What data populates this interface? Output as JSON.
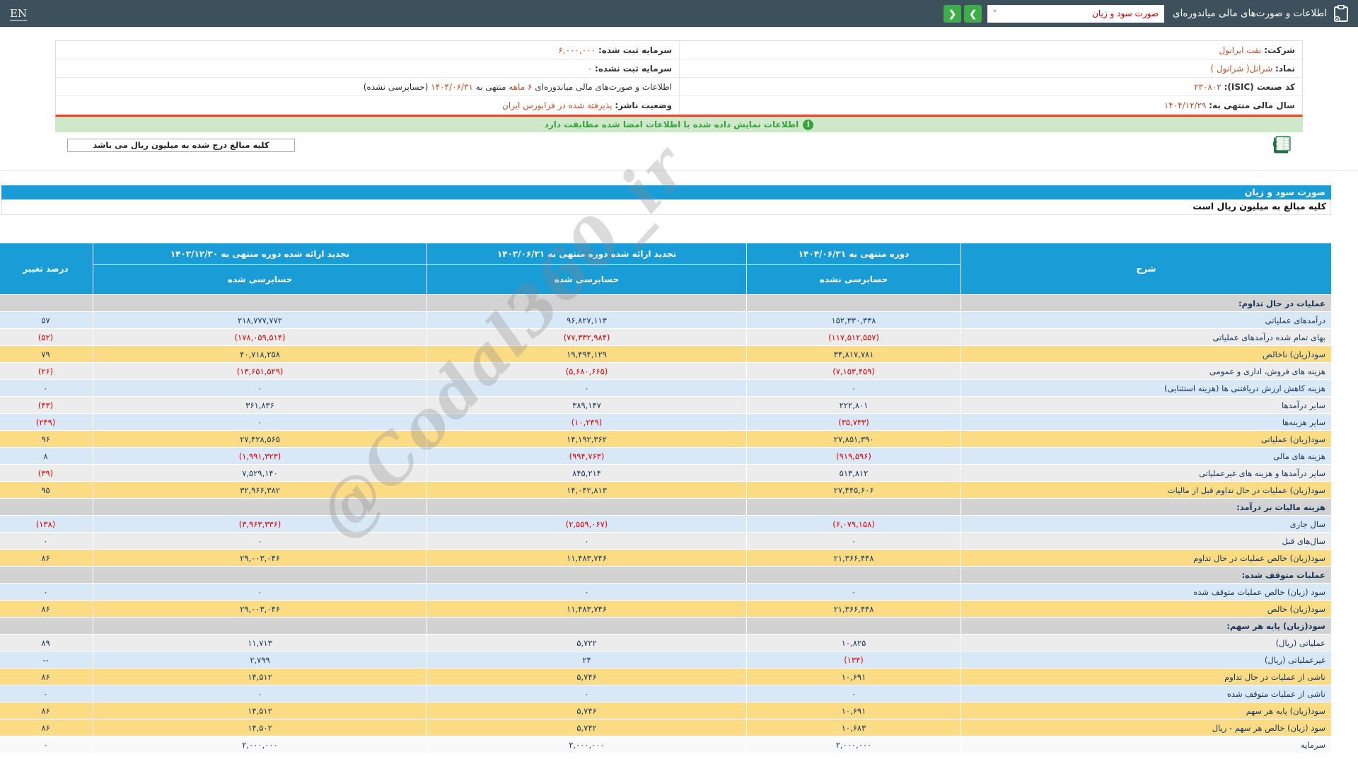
{
  "topbar": {
    "en_label": "EN",
    "title": "اطلاعات و صورت‌های مالی میاندوره‌ای",
    "select_value": "صورت سود و زیان",
    "prev_label": "❮",
    "next_label": "❯"
  },
  "company_info": {
    "right": [
      {
        "label": "شرکت:",
        "value": "نفت ایرانول"
      },
      {
        "label": "نماد:",
        "value": "شرانل( شرانول )"
      },
      {
        "label": "کد صنعت (ISIC):",
        "value": "۲۳۰۸۰۲"
      },
      {
        "label": "سال مالی منتهی به:",
        "value": "۱۴۰۴/۱۲/۲۹"
      }
    ],
    "left1": {
      "label": "سرمایه ثبت شده:",
      "value": "۶,۰۰۰,۰۰۰"
    },
    "left2": {
      "label": "سرمایه ثبت نشده:",
      "value": "۰"
    },
    "period_row": {
      "p1": "اطلاعات و صورت‌های مالی میاندوره‌ای",
      "p2": "۶ ماهه",
      "p3": "منتهی به",
      "p4": "۱۴۰۴/۰۶/۳۱",
      "p5": "(حسابرسی نشده)"
    },
    "left4": {
      "label": "وضعیت ناشر:",
      "value": "پذیرفته شده در فرابورس ایران"
    }
  },
  "notice": "اطلاعات نمایش داده شده با اطلاعات امضا شده مطابقت دارد",
  "info_icon_glyph": "i",
  "unit_box": "کلیه مبالغ درج شده به میلیون ریال می باشد",
  "statement": {
    "title": "صورت سود و زیان",
    "unit_note": "کلیه مبالغ به میلیون ریال است"
  },
  "watermark": "@Codal360_ir",
  "table": {
    "headers": {
      "sharh": "شرح",
      "col1_title": "دوره منتهی به ۱۴۰۴/۰۶/۳۱",
      "col1_sub": "حسابرسی نشده",
      "col2_title": "تجدید ارائه شده دوره منتهی به ۱۴۰۳/۰۶/۳۱",
      "col2_sub": "حسابرسی شده",
      "col3_title": "تجدید ارائه شده دوره منتهی به ۱۴۰۳/۱۲/۳۰",
      "col3_sub": "حسابرسی شده",
      "change": "درصد تغییر"
    },
    "rows": [
      {
        "style": "section",
        "label": "عملیات در حال تداوم:",
        "v": [
          "",
          "",
          ""
        ],
        "change": ""
      },
      {
        "style": "blue",
        "label": "درآمدهای عملیاتی",
        "v": [
          "۱۵۲,۳۳۰,۳۳۸",
          "۹۶,۸۲۷,۱۱۳",
          "۲۱۸,۷۷۷,۷۷۲"
        ],
        "change": "۵۷"
      },
      {
        "style": "gray",
        "label": "بهای تمام شده درآمدهای عملیاتی",
        "v": [
          "(۱۱۷,۵۱۲,۵۵۷)",
          "(۷۷,۳۳۲,۹۸۴)",
          "(۱۷۸,۰۵۹,۵۱۴)"
        ],
        "change": "(۵۲)"
      },
      {
        "style": "yellow",
        "label": "سود(زیان) ناخالص",
        "v": [
          "۳۴,۸۱۷,۷۸۱",
          "۱۹,۴۹۴,۱۲۹",
          "۴۰,۷۱۸,۲۵۸"
        ],
        "change": "۷۹"
      },
      {
        "style": "gray",
        "label": "هزینه های فروش، اداری و عمومی",
        "v": [
          "(۷,۱۵۳,۴۵۹)",
          "(۵,۶۸۰,۶۶۵)",
          "(۱۳,۶۵۱,۵۲۹)"
        ],
        "change": "(۲۶)"
      },
      {
        "style": "blue",
        "label": "هزینه کاهش ارزش دریافتنی ها (هزینه استثنایی)",
        "v": [
          "۰",
          "۰",
          "۰"
        ],
        "change": "۰"
      },
      {
        "style": "gray",
        "label": "سایر درآمدها",
        "v": [
          "۲۲۲,۸۰۱",
          "۳۸۹,۱۴۷",
          "۳۶۱,۸۳۶"
        ],
        "change": "(۴۳)"
      },
      {
        "style": "blue",
        "label": "سایر هزینه‌ها",
        "v": [
          "(۳۵,۷۳۳)",
          "(۱۰,۲۴۹)",
          "۰"
        ],
        "change": "(۲۴۹)"
      },
      {
        "style": "yellow",
        "label": "سود(زیان) عملیاتی",
        "v": [
          "۲۷,۸۵۱,۳۹۰",
          "۱۴,۱۹۲,۳۶۲",
          "۲۷,۴۲۸,۵۶۵"
        ],
        "change": "۹۶"
      },
      {
        "style": "blue",
        "label": "هزینه های مالی",
        "v": [
          "(۹۱۹,۵۹۶)",
          "(۹۹۴,۷۶۳)",
          "(۱,۹۹۱,۳۲۳)"
        ],
        "change": "۸"
      },
      {
        "style": "gray",
        "label": "سایر درآمدها و هزینه های غیرعملیاتی",
        "v": [
          "۵۱۳,۸۱۲",
          "۸۴۵,۲۱۴",
          "۷,۵۲۹,۱۴۰"
        ],
        "change": "(۳۹)"
      },
      {
        "style": "yellow",
        "label": "سود(زیان) عملیات در حال تداوم قبل از مالیات",
        "v": [
          "۲۷,۴۴۵,۶۰۶",
          "۱۴,۰۴۲,۸۱۳",
          "۳۲,۹۶۶,۳۸۲"
        ],
        "change": "۹۵"
      },
      {
        "style": "section",
        "label": "هزینه مالیات بر درآمد:",
        "v": [
          "",
          "",
          ""
        ],
        "change": ""
      },
      {
        "style": "blue",
        "label": "سال جاری",
        "v": [
          "(۶,۰۷۹,۱۵۸)",
          "(۲,۵۵۹,۰۶۷)",
          "(۳,۹۶۳,۳۳۶)"
        ],
        "change": "(۱۳۸)"
      },
      {
        "style": "gray",
        "label": "سال‌های قبل",
        "v": [
          "۰",
          "۰",
          "۰"
        ],
        "change": "۰"
      },
      {
        "style": "yellow",
        "label": "سود(زیان) خالص عملیات در حال تداوم",
        "v": [
          "۲۱,۳۶۶,۴۴۸",
          "۱۱,۴۸۳,۷۴۶",
          "۲۹,۰۰۳,۰۴۶"
        ],
        "change": "۸۶"
      },
      {
        "style": "section",
        "label": "عملیات متوقف شده:",
        "v": [
          "",
          "",
          ""
        ],
        "change": ""
      },
      {
        "style": "blue",
        "label": "سود (زیان) خالص عملیات متوقف شده",
        "v": [
          "۰",
          "۰",
          "۰"
        ],
        "change": "۰"
      },
      {
        "style": "yellow",
        "label": "سود(زیان) خالص",
        "v": [
          "۲۱,۳۶۶,۴۴۸",
          "۱۱,۴۸۳,۷۴۶",
          "۲۹,۰۰۳,۰۴۶"
        ],
        "change": "۸۶"
      },
      {
        "style": "section",
        "label": "سود(زیان) پایه هر سهم:",
        "v": [
          "",
          "",
          ""
        ],
        "change": ""
      },
      {
        "style": "gray",
        "label": "عملیاتی (ریال)",
        "v": [
          "۱۰,۸۲۵",
          "۵,۷۲۲",
          "۱۱,۷۱۳"
        ],
        "change": "۸۹"
      },
      {
        "style": "blue",
        "label": "غیرعملیاتی (ریال)",
        "v": [
          "(۱۳۴)",
          "۲۴",
          "۲,۷۹۹"
        ],
        "change": "--"
      },
      {
        "style": "yellow",
        "label": "ناشی از عملیات در حال تداوم",
        "v": [
          "۱۰,۶۹۱",
          "۵,۷۴۶",
          "۱۴,۵۱۲"
        ],
        "change": "۸۶"
      },
      {
        "style": "blue",
        "label": "ناشی از عملیات متوقف شده",
        "v": [
          "۰",
          "۰",
          "۰"
        ],
        "change": "۰"
      },
      {
        "style": "yellow",
        "label": "سود(زیان) پایه هر سهم",
        "v": [
          "۱۰,۶۹۱",
          "۵,۷۴۶",
          "۱۴,۵۱۲"
        ],
        "change": "۸۶"
      },
      {
        "style": "yellow",
        "label": "سود (زیان) خالص هر سهم - ریال",
        "v": [
          "۱۰,۶۸۳",
          "۵,۷۴۲",
          "۱۴,۵۰۲"
        ],
        "change": "۸۶"
      },
      {
        "style": "white",
        "label": "سرمایه",
        "v": [
          "۲,۰۰۰,۰۰۰",
          "۲,۰۰۰,۰۰۰",
          "۲,۰۰۰,۰۰۰"
        ],
        "change": "۰"
      }
    ]
  }
}
